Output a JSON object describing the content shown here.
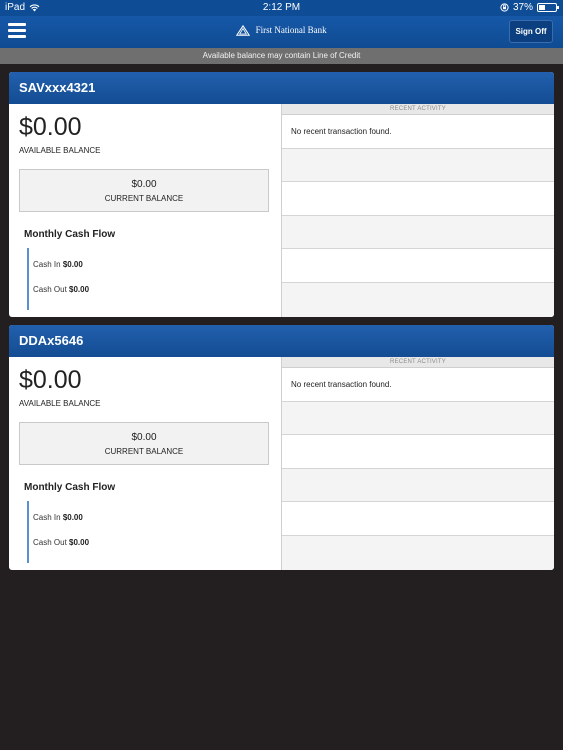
{
  "status_bar": {
    "device": "iPad",
    "time": "2:12 PM",
    "battery": "37%",
    "battery_level": 0.37
  },
  "nav": {
    "brand": "First National Bank",
    "sign_off_label": "Sign Off"
  },
  "notice": "Available balance may contain Line of Credit",
  "accounts": [
    {
      "name": "SAVxxx4321",
      "available_balance": "$0.00",
      "available_label": "AVAILABLE BALANCE",
      "current_balance": "$0.00",
      "current_label": "CURRENT BALANCE",
      "cash_flow_title": "Monthly Cash Flow",
      "cash_in_label": "Cash In",
      "cash_in_value": "$0.00",
      "cash_out_label": "Cash Out",
      "cash_out_value": "$0.00",
      "recent_activity_header": "RECENT ACTIVITY",
      "recent_activity_message": "No recent transaction found."
    },
    {
      "name": "DDAx5646",
      "available_balance": "$0.00",
      "available_label": "AVAILABLE BALANCE",
      "current_balance": "$0.00",
      "current_label": "CURRENT BALANCE",
      "cash_flow_title": "Monthly Cash Flow",
      "cash_in_label": "Cash In",
      "cash_in_value": "$0.00",
      "cash_out_label": "Cash Out",
      "cash_out_value": "$0.00",
      "recent_activity_header": "RECENT ACTIVITY",
      "recent_activity_message": "No recent transaction found."
    }
  ],
  "icons": {
    "menu": "hamburger-menu-icon",
    "wifi": "wifi-icon",
    "lock": "rotation-lock-icon",
    "battery": "battery-icon",
    "logo": "triangle-logo-icon"
  }
}
